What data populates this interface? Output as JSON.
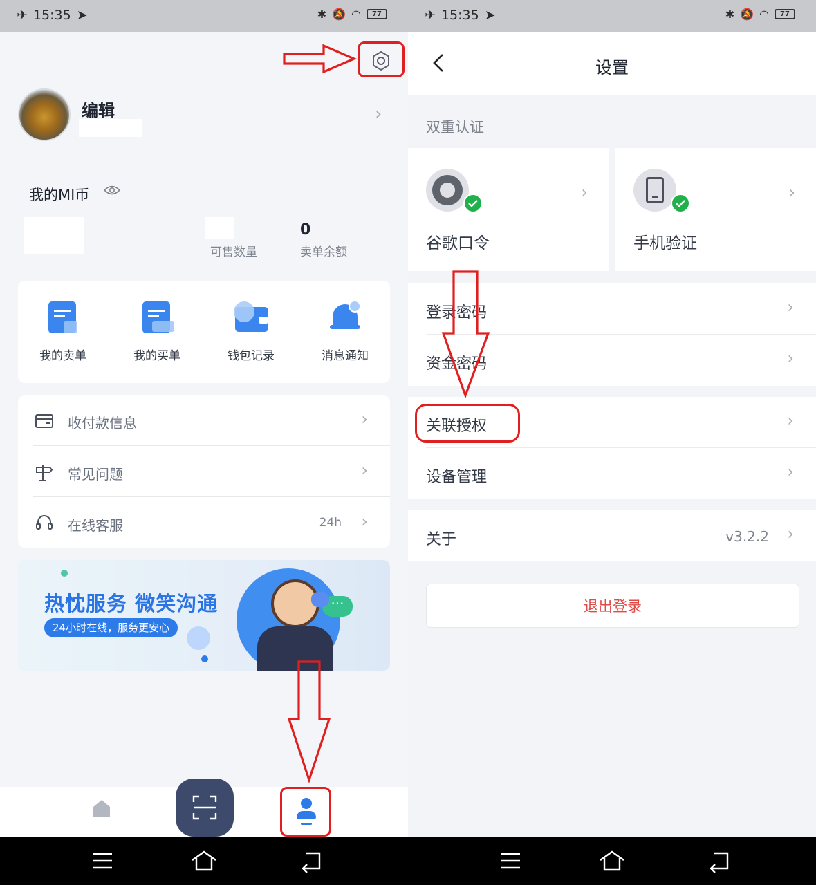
{
  "status": {
    "time": "15:35",
    "battery": "77"
  },
  "profile": {
    "name": "编辑",
    "mi_label": "我的MI币",
    "stat_sellable_label": "可售数量",
    "stat_balance_label": "卖单余额",
    "stat_balance_value": "0"
  },
  "quick_actions": [
    {
      "label": "我的卖单"
    },
    {
      "label": "我的买单"
    },
    {
      "label": "钱包记录"
    },
    {
      "label": "消息通知"
    }
  ],
  "menu": [
    {
      "label": "收付款信息",
      "value": ""
    },
    {
      "label": "常见问题",
      "value": ""
    },
    {
      "label": "在线客服",
      "value": "24h"
    }
  ],
  "banner": {
    "title": "热忱服务 微笑沟通",
    "subtitle": "24小时在线，服务更安心"
  },
  "settings": {
    "title": "设置",
    "section_2fa": "双重认证",
    "google_auth": "谷歌口令",
    "phone_auth": "手机验证",
    "login_password": "登录密码",
    "fund_password": "资金密码",
    "linked_auth": "关联授权",
    "device_mgmt": "设备管理",
    "about": "关于",
    "version": "v3.2.2",
    "logout": "退出登录"
  },
  "colors": {
    "accent": "#2d7be8",
    "annotation": "#e02020",
    "logout": "#e04b47",
    "success": "#21b14c",
    "scan": "#3e4a6b"
  }
}
